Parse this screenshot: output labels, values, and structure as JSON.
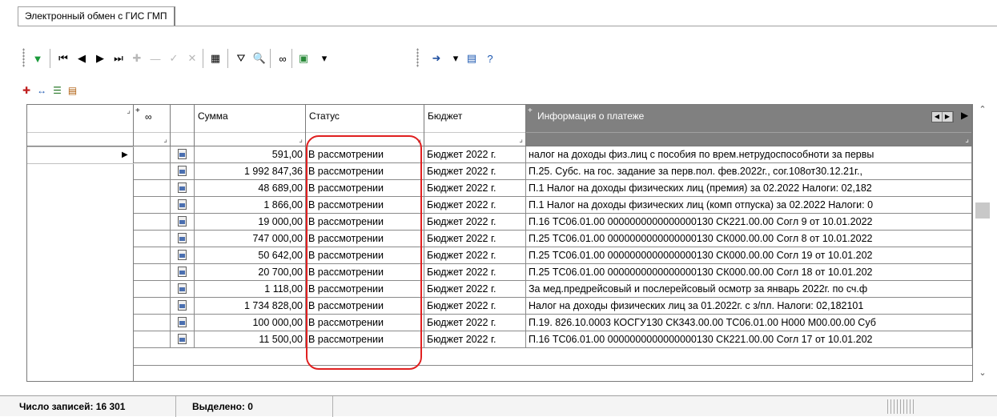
{
  "tab": {
    "title": "Электронный обмен с ГИС ГМП"
  },
  "toolbar": {
    "buttons": [
      {
        "name": "apply-filter-icon",
        "glyph": "▼"
      },
      {
        "name": "first-record-icon",
        "glyph": "⏮"
      },
      {
        "name": "prev-record-icon",
        "glyph": "◀"
      },
      {
        "name": "next-record-icon",
        "glyph": "▶"
      },
      {
        "name": "last-record-icon",
        "glyph": "⏭"
      },
      {
        "name": "insert-record-icon",
        "glyph": "✚"
      },
      {
        "name": "delete-record-icon",
        "glyph": "—"
      },
      {
        "name": "post-edit-icon",
        "glyph": "✓"
      },
      {
        "name": "cancel-edit-icon",
        "glyph": "✕"
      },
      {
        "name": "calculator-icon",
        "glyph": "▦"
      },
      {
        "name": "filter-icon",
        "glyph": "⛛"
      },
      {
        "name": "find-icon",
        "glyph": "🔍"
      },
      {
        "name": "link-icon",
        "glyph": "∞"
      },
      {
        "name": "export-icon",
        "glyph": "▣"
      },
      {
        "name": "dropdown-arrow-icon",
        "glyph": "▾"
      },
      {
        "name": "send-icon",
        "glyph": "➜"
      },
      {
        "name": "dropdown-arrow-icon-2",
        "glyph": "▾"
      },
      {
        "name": "window-icon",
        "glyph": "▤"
      },
      {
        "name": "help-icon",
        "glyph": "?"
      }
    ]
  },
  "iconrow": [
    {
      "name": "add-column-icon",
      "glyph": "✚"
    },
    {
      "name": "swap-columns-icon",
      "glyph": "↔"
    },
    {
      "name": "list-icon",
      "glyph": "☰"
    },
    {
      "name": "column-settings-icon",
      "glyph": "▤"
    }
  ],
  "grid": {
    "columns": {
      "sum": "Сумма",
      "status": "Статус",
      "budget": "Бюджет",
      "info": "Информация о платеже"
    },
    "rows": [
      {
        "sum": "591,00",
        "status": "В рассмотрении",
        "budget": "Бюджет 2022 г.",
        "info": "налог на доходы физ.лиц с пособия по врем.нетрудоспособноти за первы"
      },
      {
        "sum": "1 992 847,36",
        "status": "В рассмотрении",
        "budget": "Бюджет 2022 г.",
        "info": "П.25. Субс. на гос. задание за перв.пол. фев.2022г., сог.108от30.12.21г.,"
      },
      {
        "sum": "48 689,00",
        "status": "В рассмотрении",
        "budget": "Бюджет 2022 г.",
        "info": "П.1 Налог на доходы физических лиц (премия) за 02.2022 Налоги: 02,182"
      },
      {
        "sum": "1 866,00",
        "status": "В рассмотрении",
        "budget": "Бюджет 2022 г.",
        "info": "П.1 Налог на доходы физических лиц (комп отпуска) за 02.2022 Налоги: 0"
      },
      {
        "sum": "19 000,00",
        "status": "В рассмотрении",
        "budget": "Бюджет 2022 г.",
        "info": "П.16 ТС06.01.00 0000000000000000130 СК221.00.00 Согл 9 от 10.01.2022"
      },
      {
        "sum": "747 000,00",
        "status": "В рассмотрении",
        "budget": "Бюджет 2022 г.",
        "info": "П.25 ТС06.01.00 0000000000000000130 СК000.00.00 Согл 8 от 10.01.2022"
      },
      {
        "sum": "50 642,00",
        "status": "В рассмотрении",
        "budget": "Бюджет 2022 г.",
        "info": "П.25 ТС06.01.00 0000000000000000130 СК000.00.00 Согл 19 от 10.01.202"
      },
      {
        "sum": "20 700,00",
        "status": "В рассмотрении",
        "budget": "Бюджет 2022 г.",
        "info": "П.25 ТС06.01.00 0000000000000000130 СК000.00.00 Согл 18 от 10.01.202"
      },
      {
        "sum": "1 118,00",
        "status": "В рассмотрении",
        "budget": "Бюджет 2022 г.",
        "info": "За мед.предрейсовый и послерейсовый осмотр за январь 2022г. по сч.ф"
      },
      {
        "sum": "1 734 828,00",
        "status": "В рассмотрении",
        "budget": "Бюджет 2022 г.",
        "info": "Налог на доходы физических лиц за 01.2022г. с з/пл.  Налоги: 02,182101"
      },
      {
        "sum": "100 000,00",
        "status": "В рассмотрении",
        "budget": "Бюджет 2022 г.",
        "info": "П.19. 826.10.0003 КОСГУ130 СК343.00.00 ТС06.01.00 Н000 М00.00.00 Суб"
      },
      {
        "sum": "11 500,00",
        "status": "В рассмотрении",
        "budget": "Бюджет 2022 г.",
        "info": "П.16 ТС06.01.00 0000000000000000130 СК221.00.00 Согл 17 от 10.01.202"
      }
    ]
  },
  "status": {
    "records_label": "Число записей:",
    "records_value": "16 301",
    "selected_label": "Выделено:",
    "selected_value": "0"
  },
  "colors": {
    "highlight": "#e02020",
    "header_selected": "#808080"
  }
}
